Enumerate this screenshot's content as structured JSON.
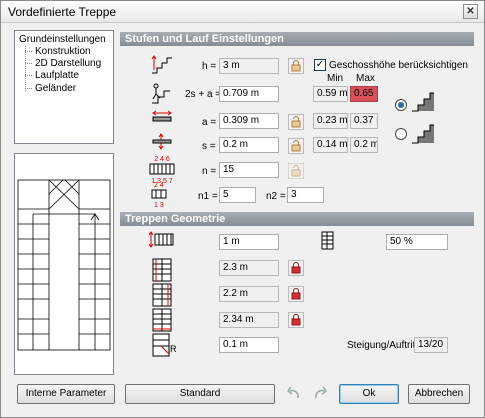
{
  "window": {
    "title": "Vordefinierte Treppe",
    "close_glyph": "✕"
  },
  "tree": {
    "root": "Grundeinstellungen",
    "children": [
      "Konstruktion",
      "2D Darstellung",
      "Laufplatte",
      "Geländer"
    ]
  },
  "stufen": {
    "header": "Stufen und Lauf Einstellungen",
    "h_label": "h =",
    "h_value": "3 m",
    "geschoss_label": "Geschosshöhe berücksichtigen",
    "min_label": "Min",
    "max_label": "Max",
    "formula_label": "2s + a =",
    "formula_value": "0.709 m",
    "formula_min": "0.59 m",
    "formula_max": "0.65 m",
    "a_label": "a =",
    "a_value": "0.309 m",
    "a_min": "0.23 m",
    "a_max": "0.37 m",
    "s_label": "s =",
    "s_value": "0.2 m",
    "s_min": "0.14 m",
    "s_max": "0.2 m",
    "n_label": "n =",
    "n_value": "15",
    "n1_label": "n1 =",
    "n1_value": "5",
    "n2_label": "n2 =",
    "n2_value": "3",
    "icon_n_top": "2 4 6",
    "icon_n_bottom": "1 3 5 7",
    "icon_n1_top": "2 4",
    "icon_n1_bottom": "1 3"
  },
  "geometrie": {
    "header": "Treppen Geometrie",
    "width_value": "1 m",
    "percent_value": "50 %",
    "len1_value": "2.3 m",
    "len2_value": "2.2 m",
    "len3_value": "2.34 m",
    "radius_value": "0.1 m",
    "radius_letter": "R",
    "ratio_label": "Steigung/Auftritt",
    "ratio_value": "13/20"
  },
  "buttons": {
    "intern": "Interne Parameter",
    "standard": "Standard",
    "ok": "Ok",
    "cancel": "Abbrechen"
  },
  "colors": {
    "header_bg": "#8e959c",
    "warning_red": "#d9505a",
    "lock_red": "#d4302f"
  }
}
